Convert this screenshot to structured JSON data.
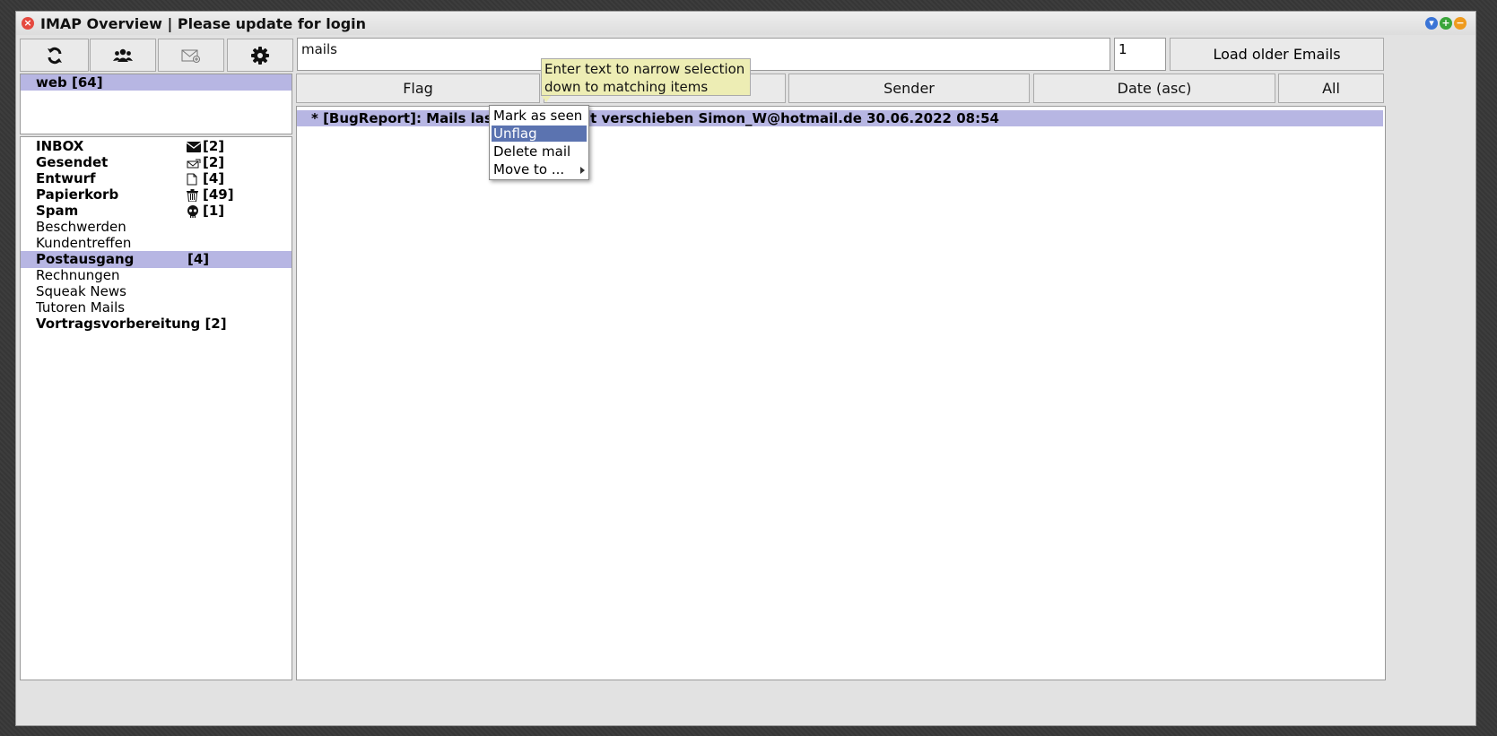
{
  "window": {
    "title": "IMAP Overview | Please update for login"
  },
  "toolbar": {
    "buttons": [
      {
        "icon": "refresh-icon"
      },
      {
        "icon": "contacts-icon"
      },
      {
        "icon": "compose-mail-icon"
      },
      {
        "icon": "settings-gear-icon"
      }
    ]
  },
  "accounts": [
    {
      "label": "web [64]"
    }
  ],
  "folders": [
    {
      "name": "INBOX",
      "icon": "envelope-icon",
      "count": "[2]",
      "bold": true
    },
    {
      "name": "Gesendet",
      "icon": "sent-icon",
      "count": "[2]",
      "bold": true
    },
    {
      "name": "Entwurf",
      "icon": "draft-icon",
      "count": "[4]",
      "bold": true
    },
    {
      "name": "Papierkorb",
      "icon": "trash-icon",
      "count": "[49]",
      "bold": true
    },
    {
      "name": "Spam",
      "icon": "skull-icon",
      "count": "[1]",
      "bold": true
    },
    {
      "name": "Beschwerden",
      "bold": false
    },
    {
      "name": "Kundentreffen",
      "bold": false
    },
    {
      "name": "Postausgang",
      "count": "[4]",
      "bold": true,
      "selected": true
    },
    {
      "name": "Rechnungen",
      "bold": false
    },
    {
      "name": "Squeak News",
      "bold": false
    },
    {
      "name": "Tutoren Mails",
      "bold": false
    },
    {
      "name": "Vortragsvorbereitung [2]",
      "bold": true
    }
  ],
  "search": {
    "value": "mails"
  },
  "count_field": {
    "value": "1"
  },
  "load_button": {
    "label": "Load older Emails"
  },
  "columns": {
    "flag": "Flag",
    "sender": "Sender",
    "date": "Date (asc)",
    "all": "All"
  },
  "mail_row": {
    "text": "* [BugReport]: Mails lassen sich nicht verschieben Simon_W@hotmail.de 30.06.2022 08:54"
  },
  "tooltip": {
    "line1": "Enter text to narrow selection",
    "line2": "down to matching items"
  },
  "context_menu": {
    "items": [
      "Mark as seen",
      "Unflag",
      "Delete mail",
      "Move to ..."
    ],
    "highlighted": "Unflag"
  },
  "colors": {
    "selection": "#b7b6e3",
    "menu_highlight": "#5b73b0",
    "tooltip_bg": "#ededb4",
    "close": "#e5483e",
    "collapse": "#3a74d6",
    "expand": "#3aa53a",
    "minimize": "#ef9b1e"
  }
}
